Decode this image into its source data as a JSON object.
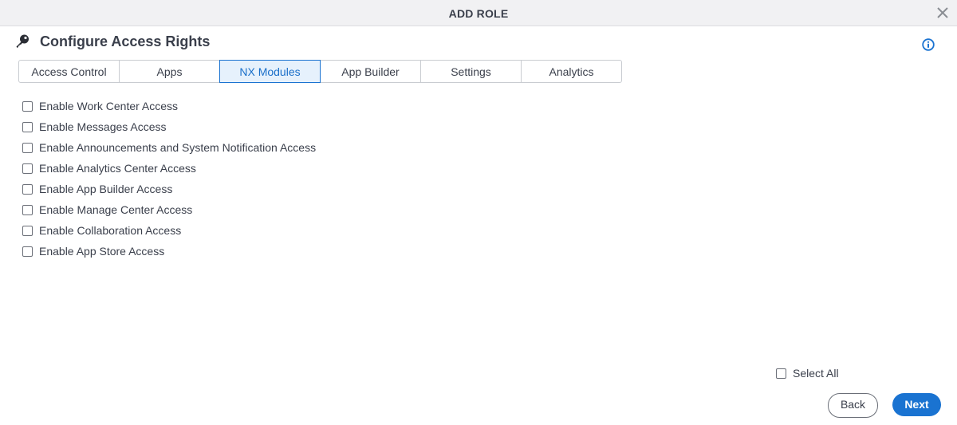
{
  "dialog": {
    "title": "ADD ROLE"
  },
  "section": {
    "heading": "Configure Access Rights"
  },
  "tabs": [
    {
      "label": "Access Control",
      "active": false
    },
    {
      "label": "Apps",
      "active": false
    },
    {
      "label": "NX Modules",
      "active": true
    },
    {
      "label": "App Builder",
      "active": false
    },
    {
      "label": "Settings",
      "active": false
    },
    {
      "label": "Analytics",
      "active": false
    }
  ],
  "options": [
    {
      "label": "Enable Work Center Access",
      "checked": false
    },
    {
      "label": "Enable Messages Access",
      "checked": false
    },
    {
      "label": "Enable Announcements and System Notification Access",
      "checked": false
    },
    {
      "label": "Enable Analytics Center Access",
      "checked": false
    },
    {
      "label": "Enable App Builder Access",
      "checked": false
    },
    {
      "label": "Enable Manage Center Access",
      "checked": false
    },
    {
      "label": "Enable Collaboration Access",
      "checked": false
    },
    {
      "label": "Enable App Store Access",
      "checked": false
    }
  ],
  "select_all": {
    "label": "Select All",
    "checked": false
  },
  "footer": {
    "back_label": "Back",
    "next_label": "Next"
  },
  "icons": {
    "close": "close-icon",
    "key": "key-icon",
    "info": "info-icon"
  },
  "colors": {
    "accent": "#1a73d1",
    "active_tab_bg": "#e6f1fc",
    "titlebar_bg": "#f1f1f3",
    "text": "#3a3f4b"
  }
}
